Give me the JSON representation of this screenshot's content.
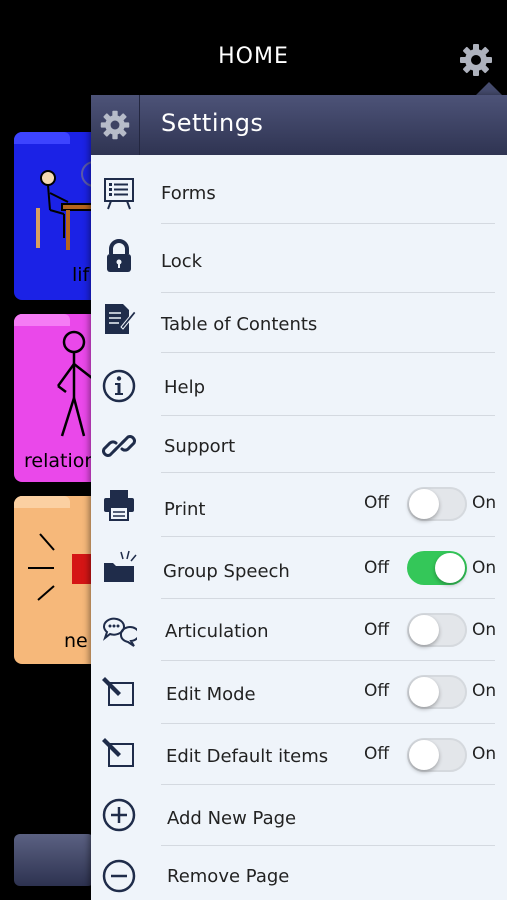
{
  "header": {
    "title": "HOME"
  },
  "panel": {
    "title": "Settings"
  },
  "background_folders": [
    {
      "label": "lif"
    },
    {
      "label": "relation"
    },
    {
      "label": "ne"
    }
  ],
  "menu": {
    "forms": {
      "label": "Forms"
    },
    "lock": {
      "label": "Lock"
    },
    "toc": {
      "label": "Table of Contents"
    },
    "help": {
      "label": "Help"
    },
    "support": {
      "label": "Support"
    },
    "print": {
      "label": "Print",
      "off": "Off",
      "on": "On",
      "state": "off"
    },
    "group_speech": {
      "label": "Group Speech",
      "off": "Off",
      "on": "On",
      "state": "on"
    },
    "articulation": {
      "label": "Articulation",
      "off": "Off",
      "on": "On",
      "state": "off"
    },
    "edit_mode": {
      "label": "Edit Mode",
      "off": "Off",
      "on": "On",
      "state": "off"
    },
    "edit_default": {
      "label": "Edit Default items",
      "off": "Off",
      "on": "On",
      "state": "off"
    },
    "add_page": {
      "label": "Add New Page"
    },
    "remove_page": {
      "label": "Remove Page"
    }
  },
  "colors": {
    "toggle_on": "#34c759",
    "panel_bg": "#eff4fa",
    "header_bg": "#3a3f61",
    "icon": "#1f2c4a"
  }
}
